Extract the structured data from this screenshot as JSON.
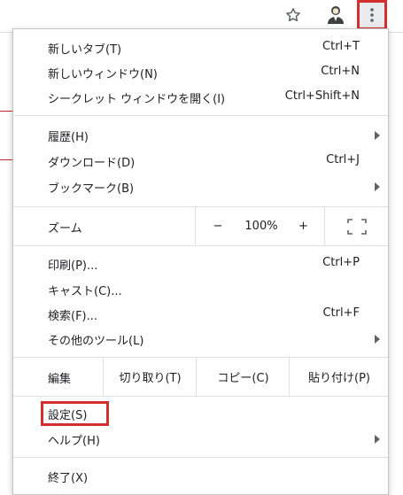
{
  "toolbar": {
    "bookmark_icon": "star-outline-icon",
    "profile_icon": "person-avatar-icon",
    "menu_icon": "three-dots-vertical-icon",
    "highlight_color": "#d32f2f"
  },
  "menu": {
    "new_tab": {
      "label": "新しいタブ(T)",
      "shortcut": "Ctrl+T"
    },
    "new_window": {
      "label": "新しいウィンドウ(N)",
      "shortcut": "Ctrl+N"
    },
    "incognito": {
      "label": "シークレット ウィンドウを開く(I)",
      "shortcut": "Ctrl+Shift+N"
    },
    "history": {
      "label": "履歴(H)"
    },
    "downloads": {
      "label": "ダウンロード(D)",
      "shortcut": "Ctrl+J"
    },
    "bookmarks": {
      "label": "ブックマーク(B)"
    },
    "zoom": {
      "label": "ズーム",
      "minus": "−",
      "value": "100%",
      "plus": "+"
    },
    "print": {
      "label": "印刷(P)...",
      "shortcut": "Ctrl+P"
    },
    "cast": {
      "label": "キャスト(C)..."
    },
    "find": {
      "label": "検索(F)...",
      "shortcut": "Ctrl+F"
    },
    "more_tools": {
      "label": "その他のツール(L)"
    },
    "edit": {
      "label": "編集",
      "cut": "切り取り(T)",
      "copy": "コピー(C)",
      "paste": "貼り付け(P)"
    },
    "settings": {
      "label": "設定(S)"
    },
    "help": {
      "label": "ヘルプ(H)"
    },
    "exit": {
      "label": "終了(X)"
    }
  }
}
